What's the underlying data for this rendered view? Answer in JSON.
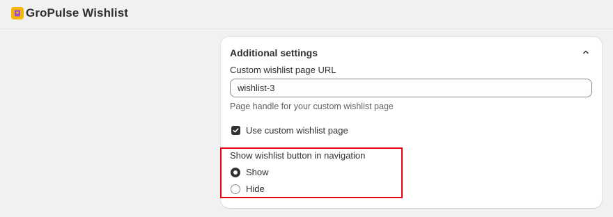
{
  "header": {
    "app_title": "GroPulse Wishlist",
    "logo_icon": "gropulse-logo-icon",
    "logo_color": "#f5b800"
  },
  "settings_card": {
    "title": "Additional settings",
    "collapse_icon": "chevron-up-icon",
    "url_field": {
      "label": "Custom wishlist page URL",
      "value": "wishlist-3",
      "help_text": "Page handle for your custom wishlist page"
    },
    "use_custom_page": {
      "label": "Use custom wishlist page",
      "checked": true
    },
    "navigation_button": {
      "label": "Show wishlist button in navigation",
      "options": [
        {
          "label": "Show",
          "selected": true
        },
        {
          "label": "Hide",
          "selected": false
        }
      ]
    }
  },
  "annotation": {
    "highlight_color": "#e60012"
  }
}
